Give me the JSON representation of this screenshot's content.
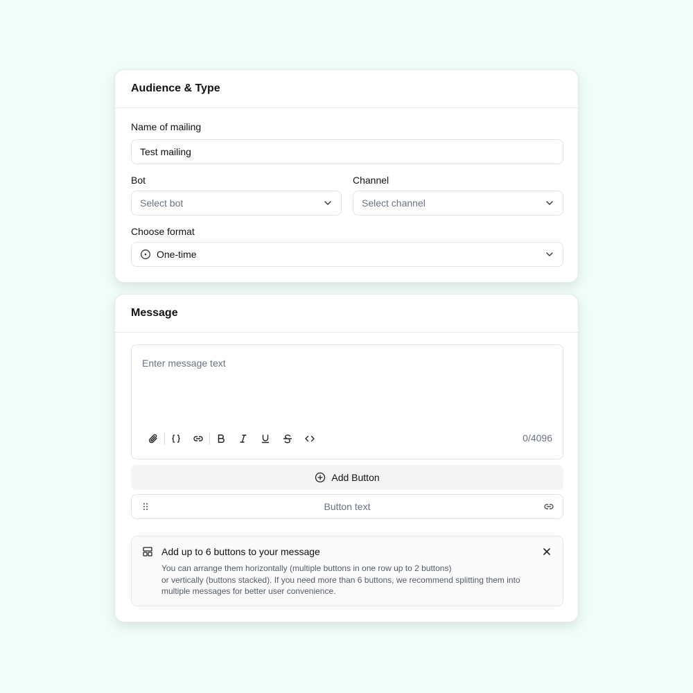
{
  "audience": {
    "title": "Audience & Type",
    "name_label": "Name of mailing",
    "name_value": "Test mailing",
    "bot_label": "Bot",
    "bot_placeholder": "Select bot",
    "channel_label": "Channel",
    "channel_placeholder": "Select channel",
    "format_label": "Choose format",
    "format_value": "One-time"
  },
  "message": {
    "title": "Message",
    "placeholder": "Enter message text",
    "counter": "0/4096",
    "toolbar_icons": [
      "paperclip-icon",
      "braces-icon",
      "link-icon",
      "bold-icon",
      "italic-icon",
      "underline-icon",
      "strikethrough-icon",
      "code-icon"
    ],
    "add_button_label": "Add Button",
    "button_text_placeholder": "Button text",
    "info_title": "Add up to 6 buttons to your message",
    "info_line1": "You can arrange them horizontally (multiple buttons in one row up to 2 buttons)",
    "info_line2": "or vertically (buttons stacked). If you need more than 6 buttons, we recommend splitting them into",
    "info_line3": "multiple messages for better user convenience."
  },
  "colors": {
    "background": "#f0fdf9",
    "card": "#ffffff",
    "border": "#e5e7eb",
    "muted_text": "#6b7280"
  }
}
